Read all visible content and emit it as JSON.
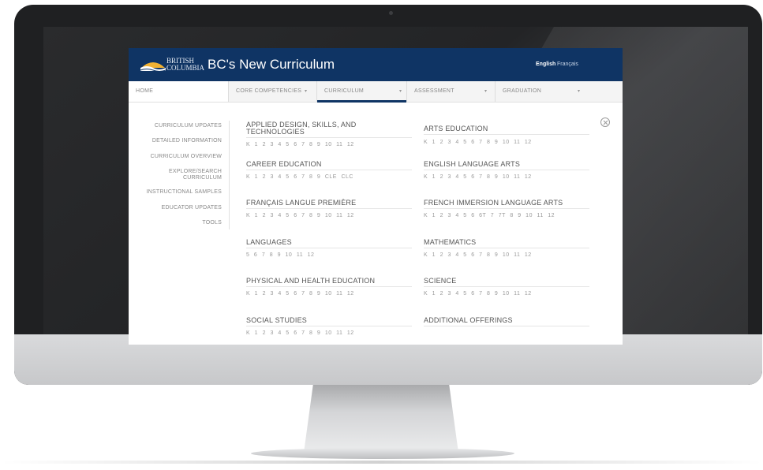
{
  "site": {
    "logo_text_line1": "BRITISH",
    "logo_text_line2": "COLUMBIA",
    "title": "BC's New Curriculum",
    "lang_english": "English",
    "lang_french": "Français",
    "header_color": "#0f3464"
  },
  "nav": {
    "home": "HOME",
    "core": "CORE COMPETENCIES",
    "curriculum": "CURRICULUM",
    "assessment": "ASSESSMENT",
    "graduation": "GRADUATION",
    "caret": "▾"
  },
  "sidebar": [
    "CURRICULUM UPDATES",
    "DETAILED INFORMATION",
    "CURRICULUM OVERVIEW",
    "EXPLORE/SEARCH CURRICULUM",
    "INSTRUCTIONAL SAMPLES",
    "EDUCATOR UPDATES",
    "TOOLS"
  ],
  "subjects": [
    {
      "title": "APPLIED DESIGN, SKILLS, AND TECHNOLOGIES",
      "grades": [
        "K",
        "1",
        "2",
        "3",
        "4",
        "5",
        "6",
        "7",
        "8",
        "9",
        "10",
        "11",
        "12"
      ]
    },
    {
      "title": "ARTS EDUCATION",
      "grades": [
        "K",
        "1",
        "2",
        "3",
        "4",
        "5",
        "6",
        "7",
        "8",
        "9",
        "10",
        "11",
        "12"
      ]
    },
    {
      "title": "CAREER EDUCATION",
      "grades": [
        "K",
        "1",
        "2",
        "3",
        "4",
        "5",
        "6",
        "7",
        "8",
        "9",
        "CLE",
        "CLC"
      ]
    },
    {
      "title": "ENGLISH LANGUAGE ARTS",
      "grades": [
        "K",
        "1",
        "2",
        "3",
        "4",
        "5",
        "6",
        "7",
        "8",
        "9",
        "10",
        "11",
        "12"
      ]
    },
    {
      "title": "FRANÇAIS LANGUE PREMIÈRE",
      "grades": [
        "K",
        "1",
        "2",
        "3",
        "4",
        "5",
        "6",
        "7",
        "8",
        "9",
        "10",
        "11",
        "12"
      ]
    },
    {
      "title": "FRENCH IMMERSION LANGUAGE ARTS",
      "grades": [
        "K",
        "1",
        "2",
        "3",
        "4",
        "5",
        "6",
        "6T",
        "7",
        "7T",
        "8",
        "9",
        "10",
        "11",
        "12"
      ]
    },
    {
      "title": "LANGUAGES",
      "grades": [
        "5",
        "6",
        "7",
        "8",
        "9",
        "10",
        "11",
        "12"
      ]
    },
    {
      "title": "MATHEMATICS",
      "grades": [
        "K",
        "1",
        "2",
        "3",
        "4",
        "5",
        "6",
        "7",
        "8",
        "9",
        "10",
        "11",
        "12"
      ]
    },
    {
      "title": "PHYSICAL AND HEALTH EDUCATION",
      "grades": [
        "K",
        "1",
        "2",
        "3",
        "4",
        "5",
        "6",
        "7",
        "8",
        "9",
        "10",
        "11",
        "12"
      ]
    },
    {
      "title": "SCIENCE",
      "grades": [
        "K",
        "1",
        "2",
        "3",
        "4",
        "5",
        "6",
        "7",
        "8",
        "9",
        "10",
        "11",
        "12"
      ]
    },
    {
      "title": "SOCIAL STUDIES",
      "grades": [
        "K",
        "1",
        "2",
        "3",
        "4",
        "5",
        "6",
        "7",
        "8",
        "9",
        "10",
        "11",
        "12"
      ]
    },
    {
      "title": "ADDITIONAL OFFERINGS",
      "grades": []
    }
  ]
}
